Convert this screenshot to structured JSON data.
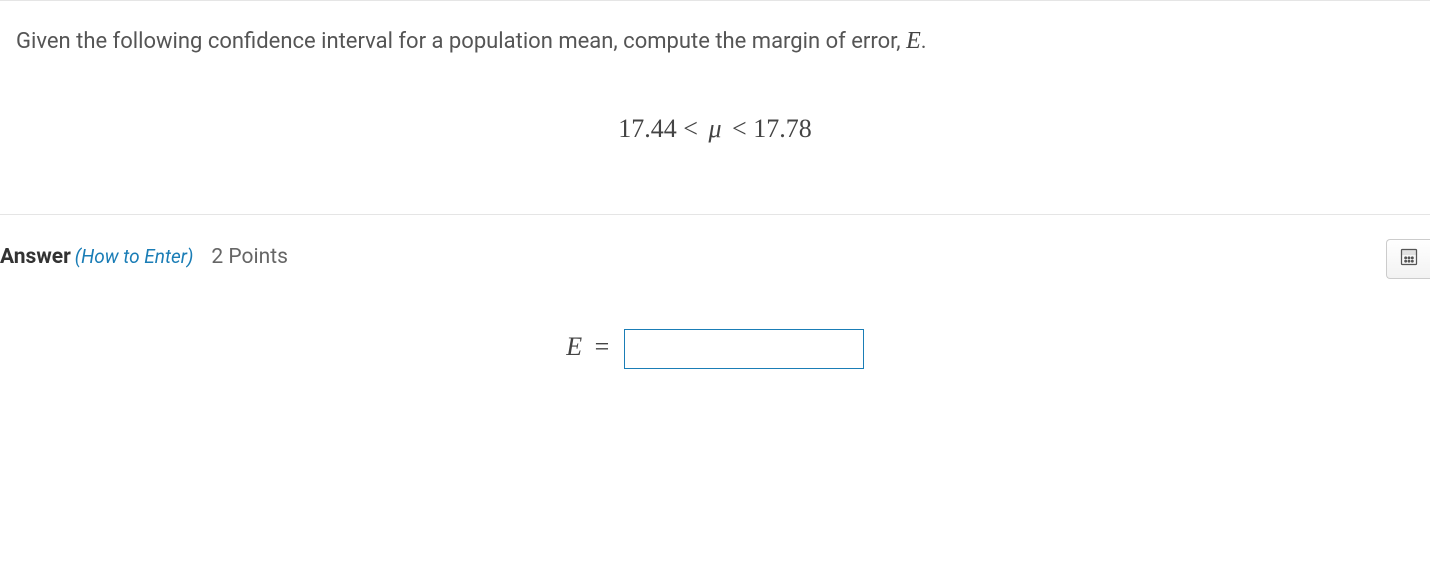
{
  "question": {
    "prompt_prefix": "Given the following confidence interval for a population mean, compute the margin of error, ",
    "prompt_var": "E",
    "prompt_suffix": ".",
    "interval_lower": "17.44",
    "interval_symbol": "μ",
    "interval_upper": "17.78"
  },
  "answer": {
    "label": "Answer",
    "howto": "(How to Enter)",
    "points": "2 Points",
    "expr_var": "E",
    "expr_eq": "=",
    "input_value": ""
  }
}
